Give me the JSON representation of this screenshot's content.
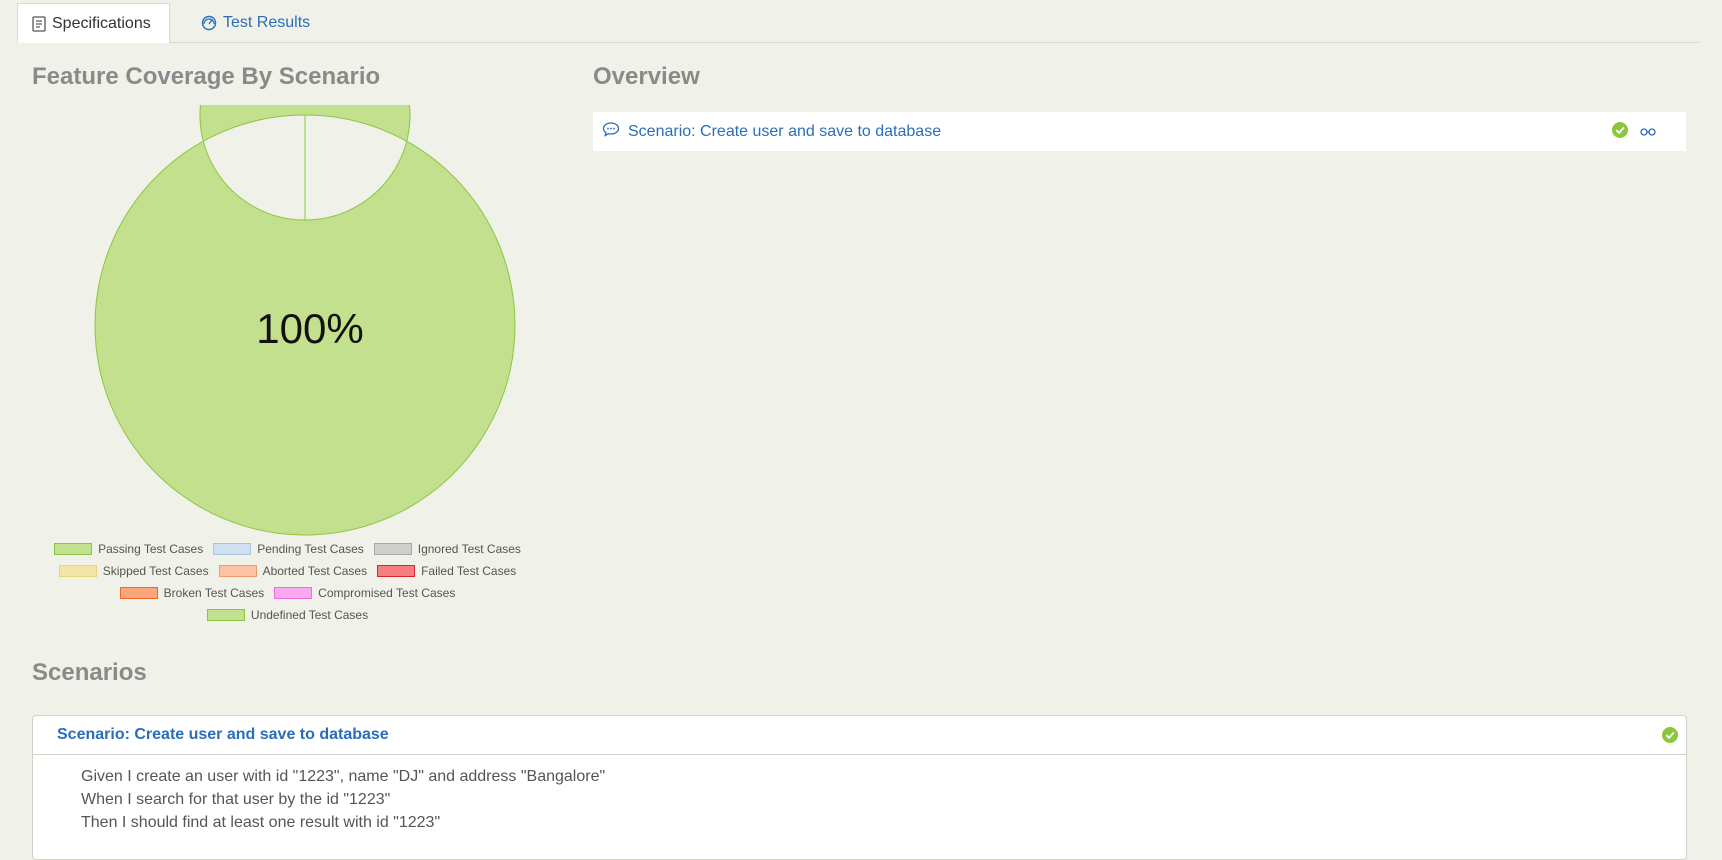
{
  "tabs": [
    {
      "label": "Specifications",
      "icon": "document-icon",
      "active": true
    },
    {
      "label": "Test Results",
      "icon": "dashboard-icon",
      "active": false
    }
  ],
  "coverage": {
    "title": "Feature Coverage By Scenario",
    "center_label": "100%"
  },
  "chart_data": {
    "type": "pie",
    "donut": true,
    "series": [
      {
        "name": "Passing Test Cases",
        "value": 1,
        "color": "#c3e08f",
        "border": "#8cc63f"
      },
      {
        "name": "Pending Test Cases",
        "value": 0,
        "color": "#cfe0ee",
        "border": "#a8c3dc"
      },
      {
        "name": "Ignored Test Cases",
        "value": 0,
        "color": "#cfcfcb",
        "border": "#a8a8a8"
      },
      {
        "name": "Skipped Test Cases",
        "value": 0,
        "color": "#f3e5a6",
        "border": "#e8d47a"
      },
      {
        "name": "Aborted Test Cases",
        "value": 0,
        "color": "#fbc2a4",
        "border": "#f19a6c"
      },
      {
        "name": "Failed Test Cases",
        "value": 0,
        "color": "#f67d80",
        "border": "#d9262e"
      },
      {
        "name": "Broken Test Cases",
        "value": 0,
        "color": "#fba57d",
        "border": "#f06a26"
      },
      {
        "name": "Compromised Test Cases",
        "value": 0,
        "color": "#f9a9f0",
        "border": "#ea6fe0"
      },
      {
        "name": "Undefined Test Cases",
        "value": 0,
        "color": "#c3e08f",
        "border": "#8cc63f"
      }
    ],
    "legend_rows": [
      [
        0,
        1,
        2
      ],
      [
        3,
        4,
        5
      ],
      [
        6,
        7
      ],
      [
        8
      ]
    ],
    "legend_position": "bottom"
  },
  "overview": {
    "title": "Overview",
    "items": [
      {
        "label": "Scenario: Create user and save to database",
        "status": "passed"
      }
    ]
  },
  "scenarios": {
    "title": "Scenarios",
    "items": [
      {
        "title": "Scenario: Create user and save to database",
        "status": "passed",
        "steps": [
          "Given I create an user with id \"1223\", name \"DJ\" and address \"Bangalore\"",
          "When I search for that user by the id \"1223\"",
          "Then I should find at least one result with id \"1223\""
        ]
      }
    ]
  },
  "colors": {
    "link": "#2a6ebb",
    "pass": "#8cc63f",
    "heading": "#8a8a8a",
    "background": "#f0f1e9"
  }
}
